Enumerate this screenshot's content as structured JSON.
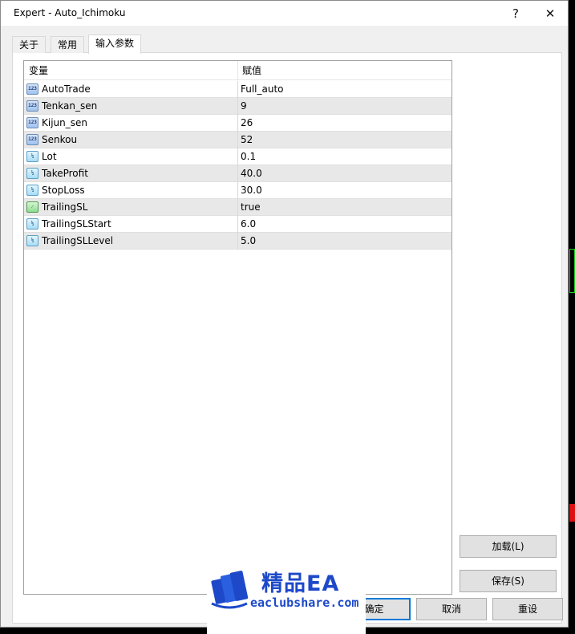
{
  "window": {
    "title": "Expert - Auto_Ichimoku",
    "help_glyph": "?",
    "close_glyph": "✕"
  },
  "tabs": [
    {
      "label": "关于",
      "active": false
    },
    {
      "label": "常用",
      "active": false
    },
    {
      "label": "输入参数",
      "active": true
    }
  ],
  "grid": {
    "col_variable": "变量",
    "col_value": "赋值",
    "rows": [
      {
        "name": "AutoTrade",
        "value": "Full_auto",
        "type": "int-icon"
      },
      {
        "name": "Tenkan_sen",
        "value": "9",
        "type": "int-icon"
      },
      {
        "name": "Kijun_sen",
        "value": "26",
        "type": "int-icon"
      },
      {
        "name": "Senkou",
        "value": "52",
        "type": "int-icon"
      },
      {
        "name": "Lot",
        "value": "0.1",
        "type": "double-icon"
      },
      {
        "name": "TakeProfit",
        "value": "40.0",
        "type": "double-icon"
      },
      {
        "name": "StopLoss",
        "value": "30.0",
        "type": "double-icon"
      },
      {
        "name": "TrailingSL",
        "value": "true",
        "type": "bool-icon"
      },
      {
        "name": "TrailingSLStart",
        "value": "6.0",
        "type": "double-icon"
      },
      {
        "name": "TrailingSLLevel",
        "value": "5.0",
        "type": "double-icon"
      }
    ]
  },
  "buttons": {
    "load": "加载(L)",
    "save": "保存(S)",
    "ok": "确定",
    "cancel": "取消",
    "reset": "重设"
  },
  "watermark": {
    "title": "精品EA",
    "url": "eaclubshare.com"
  },
  "colors": {
    "accent": "#0078d7",
    "watermark_blue": "#1d49c9"
  }
}
